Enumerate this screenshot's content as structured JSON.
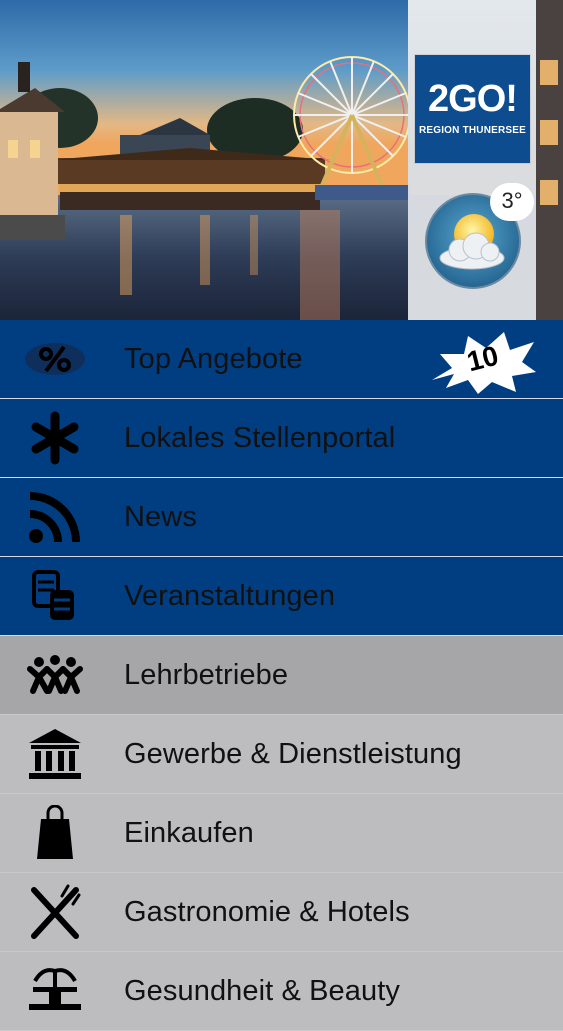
{
  "header": {
    "logo_main": "2GO!",
    "logo_sub": "REGION THUNERSEE",
    "temperature": "3°",
    "weather_icon": "partly-cloudy-icon"
  },
  "menu": {
    "items": [
      {
        "label": "Top Angebote",
        "icon": "percent-tag-icon",
        "badge": "10"
      },
      {
        "label": "Lokales Stellenportal",
        "icon": "asterisk-icon"
      },
      {
        "label": "News",
        "icon": "rss-feed-icon"
      },
      {
        "label": "Veranstaltungen",
        "icon": "ticket-stack-icon"
      },
      {
        "label": "Lehrbetriebe",
        "icon": "people-group-icon"
      },
      {
        "label": "Gewerbe & Dienstleistung",
        "icon": "bank-building-icon"
      },
      {
        "label": "Einkaufen",
        "icon": "shopping-bag-icon"
      },
      {
        "label": "Gastronomie & Hotels",
        "icon": "knife-fork-icon"
      },
      {
        "label": "Gesundheit & Beauty",
        "icon": "fountain-icon"
      }
    ]
  },
  "colors": {
    "primary_blue": "#003e81",
    "logo_blue": "#0d4c8f",
    "menu_gray": "#bdbdbf",
    "selected_gray": "#a6a6a8"
  }
}
